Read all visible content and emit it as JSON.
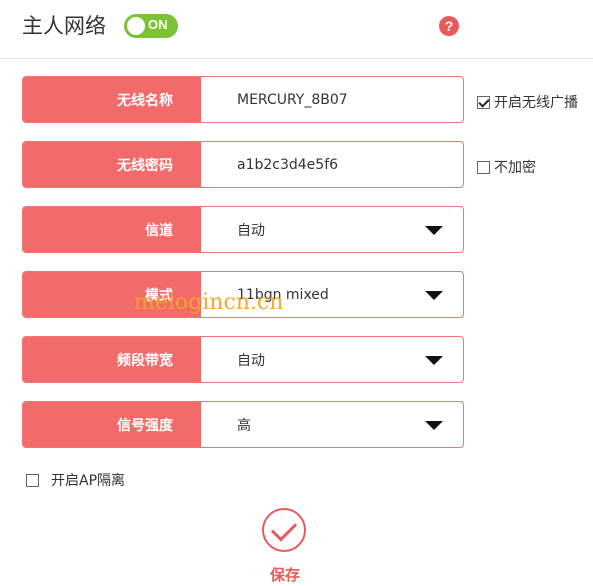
{
  "header": {
    "title": "主人网络",
    "toggle_label": "ON",
    "help_label": "?"
  },
  "form": {
    "fields": [
      {
        "label": "无线名称",
        "value": "MERCURY_8B07",
        "type": "text"
      },
      {
        "label": "无线密码",
        "value": "a1b2c3d4e5f6",
        "type": "text"
      },
      {
        "label": "信道",
        "value": "自动",
        "type": "select"
      },
      {
        "label": "模式",
        "value": "11bgn mixed",
        "type": "select"
      },
      {
        "label": "频段带宽",
        "value": "自动",
        "type": "select"
      },
      {
        "label": "信号强度",
        "value": "高",
        "type": "select"
      }
    ],
    "broadcast_checkbox": {
      "label": "开启无线广播",
      "checked": true
    },
    "no_encrypt_checkbox": {
      "label": "不加密",
      "checked": false
    },
    "ap_isolation_checkbox": {
      "label": "开启AP隔离",
      "checked": false
    },
    "save_label": "保存"
  },
  "watermark": "melogincn.cn",
  "colors": {
    "accent": "#f36a6a",
    "toggle_on": "#7cc235",
    "watermark": "#f5a623"
  }
}
